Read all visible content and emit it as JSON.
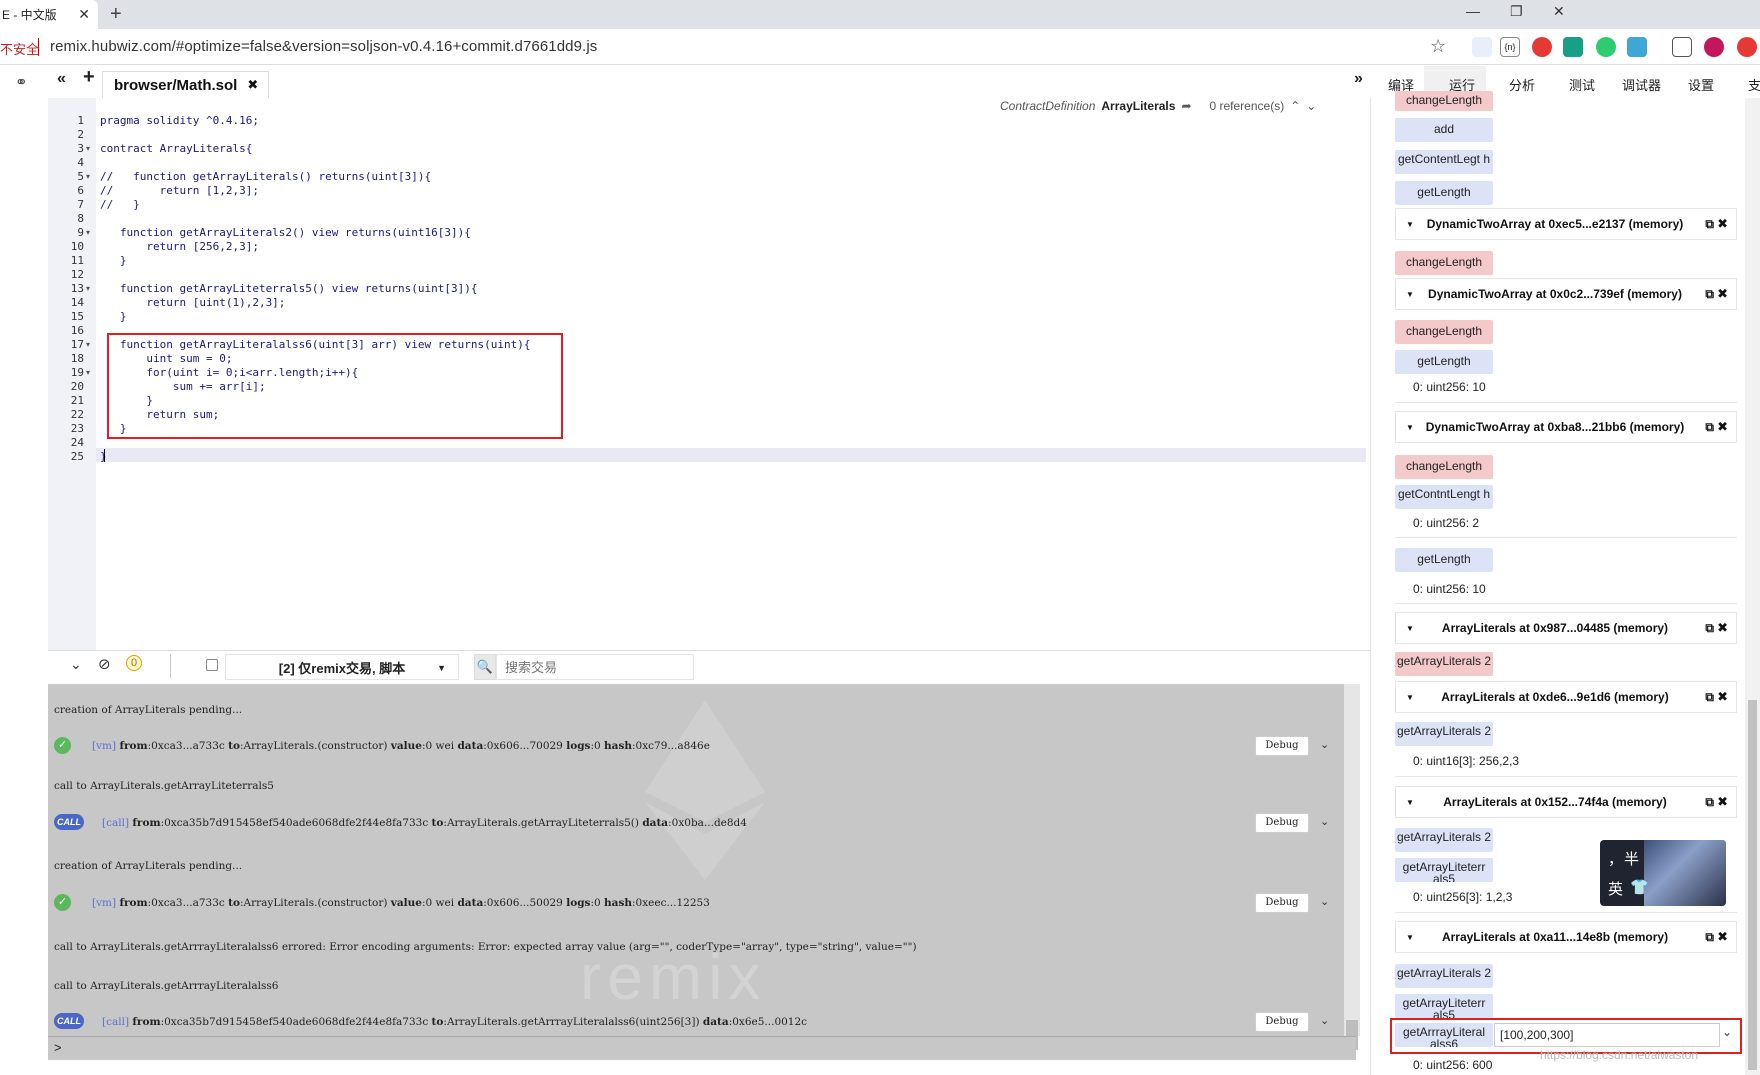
{
  "browser": {
    "tab_title": "E - 中文版",
    "tab_close": "✕",
    "new_tab": "+",
    "insecure_label": "不安全",
    "url": "remix.hubwiz.com/#optimize=false&version=soljson-v0.4.16+commit.d7661dd9.js",
    "window_buttons": [
      "—",
      "❐",
      "✕"
    ]
  },
  "remix": {
    "file_tab": "browser/Math.sol",
    "file_tab_close": "✖",
    "right_tabs": [
      "编译",
      "运行",
      "分析",
      "测试",
      "调试器",
      "设置",
      "支"
    ],
    "context_bar": {
      "kind": "ContractDefinition",
      "name": "ArrayLiterals",
      "refs": "0 reference(s)"
    }
  },
  "editor": {
    "lines": [
      {
        "n": "1",
        "t": "pragma solidity ^0.4.16;"
      },
      {
        "n": "2",
        "t": ""
      },
      {
        "n": "3",
        "t": "contract ArrayLiterals{",
        "f": true
      },
      {
        "n": "4",
        "t": ""
      },
      {
        "n": "5",
        "t": "//   function getArrayLiterals() returns(uint[3]){",
        "f": true
      },
      {
        "n": "6",
        "t": "//       return [1,2,3];"
      },
      {
        "n": "7",
        "t": "//   }"
      },
      {
        "n": "8",
        "t": ""
      },
      {
        "n": "9",
        "t": "   function getArrayLiterals2() view returns(uint16[3]){",
        "f": true
      },
      {
        "n": "10",
        "t": "       return [256,2,3];"
      },
      {
        "n": "11",
        "t": "   }"
      },
      {
        "n": "12",
        "t": ""
      },
      {
        "n": "13",
        "t": "   function getArrayLiteterrals5() view returns(uint[3]){",
        "f": true
      },
      {
        "n": "14",
        "t": "       return [uint(1),2,3];"
      },
      {
        "n": "15",
        "t": "   }"
      },
      {
        "n": "16",
        "t": ""
      },
      {
        "n": "17",
        "t": "   function getArrayLiteralalss6(uint[3] arr) view returns(uint){",
        "f": true
      },
      {
        "n": "18",
        "t": "       uint sum = 0;"
      },
      {
        "n": "19",
        "t": "       for(uint i= 0;i<arr.length;i++){",
        "f": true
      },
      {
        "n": "20",
        "t": "           sum += arr[i];"
      },
      {
        "n": "21",
        "t": "       }"
      },
      {
        "n": "22",
        "t": "       return sum;"
      },
      {
        "n": "23",
        "t": "   }"
      },
      {
        "n": "24",
        "t": ""
      },
      {
        "n": "25",
        "t": "}"
      }
    ]
  },
  "terminal": {
    "pending_count": "0",
    "filter_label": "[2] 仅remix交易, 脚本",
    "search_placeholder": "搜索交易",
    "debug_label": "Debug",
    "watermark": "remix",
    "prompt": ">",
    "logs": [
      {
        "kind": "text",
        "text": "creation of ArrayLiterals pending..."
      },
      {
        "kind": "vm",
        "tag": "[vm]",
        "parts": [
          "from",
          ":0xca3...a733c ",
          "to",
          ":ArrayLiterals.(constructor) ",
          "value",
          ":0 wei ",
          "data",
          ":0x606...70029 ",
          "logs",
          ":0 ",
          "hash",
          ":0xc79...a846e"
        ]
      },
      {
        "kind": "text",
        "text": "call to ArrayLiterals.getArrayLiteterrals5"
      },
      {
        "kind": "call",
        "tag": "[call]",
        "parts": [
          "from",
          ":0xca35b7d915458ef540ade6068dfe2f44e8fa733c ",
          "to",
          ":ArrayLiterals.getArrayLiteterrals5() ",
          "data",
          ":0x0ba...de8d4"
        ]
      },
      {
        "kind": "text",
        "text": "creation of ArrayLiterals pending..."
      },
      {
        "kind": "vm",
        "tag": "[vm]",
        "parts": [
          "from",
          ":0xca3...a733c ",
          "to",
          ":ArrayLiterals.(constructor) ",
          "value",
          ":0 wei ",
          "data",
          ":0x606...50029 ",
          "logs",
          ":0 ",
          "hash",
          ":0xeec...12253"
        ]
      },
      {
        "kind": "text",
        "text": "call to ArrayLiterals.getArrrayLiteralalss6 errored: Error encoding arguments: Error: expected array value (arg=\"\", coderType=\"array\", type=\"string\", value=\"\")"
      },
      {
        "kind": "text",
        "text": "call to ArrayLiterals.getArrrayLiteralalss6"
      },
      {
        "kind": "call",
        "tag": "[call]",
        "parts": [
          "from",
          ":0xca35b7d915458ef540ade6068dfe2f44e8fa733c ",
          "to",
          ":ArrayLiterals.getArrrayLiteralalss6(uint256[3]) ",
          "data",
          ":0x6e5...0012c"
        ]
      }
    ],
    "call_icon": "CALL",
    "ok_icon": "✓"
  },
  "run_panel": {
    "buttons_top": [
      {
        "label": "changeLength",
        "red": true
      },
      {
        "label": "add",
        "red": false
      },
      {
        "label": "getContentLegt h",
        "red": false
      },
      {
        "label": "getLength",
        "red": false
      }
    ],
    "inst1": {
      "title": "DynamicTwoArray at 0xec5...e2137 (memory)",
      "btn": "changeLength"
    },
    "inst2": {
      "title": "DynamicTwoArray at 0x0c2...739ef (memory)",
      "btn1": "changeLength",
      "btn2": "getLength",
      "result": "0: uint256: 10"
    },
    "inst3": {
      "title": "DynamicTwoArray at 0xba8...21bb6 (memory)",
      "btn1": "changeLength",
      "btn2": "getContntLengt h",
      "result1": "0: uint256: 2",
      "btn3": "getLength",
      "result2": "0: uint256: 10"
    },
    "inst4": {
      "title": "ArrayLiterals at 0x987...04485 (memory)",
      "btn": "getArrayLiterals 2"
    },
    "inst5": {
      "title": "ArrayLiterals at 0xde6...9e1d6 (memory)",
      "btn": "getArrayLiterals 2",
      "result": "0: uint16[3]: 256,2,3"
    },
    "inst6": {
      "title": "ArrayLiterals at 0x152...74f4a (memory)",
      "btn1": "getArrayLiterals 2",
      "btn2": "getArrayLiteterr als5",
      "result": "0: uint256[3]: 1,2,3"
    },
    "inst7": {
      "title": "ArrayLiterals at 0xa11...14e8b (memory)",
      "btn1": "getArrayLiterals 2",
      "btn2": "getArrayLiteterr als5",
      "btn3": "getArrrayLiteral alss6",
      "input": "[100,200,300]",
      "result": "0: uint256: 600"
    },
    "copy_icon": "⧉",
    "close_icon": "✖",
    "collapse_icon": "▼"
  },
  "overlay": {
    "csdn_watermark": "https://blog.csdn.net/aiwaston",
    "ime_chars": [
      "，",
      "半",
      "英",
      "👕"
    ]
  }
}
